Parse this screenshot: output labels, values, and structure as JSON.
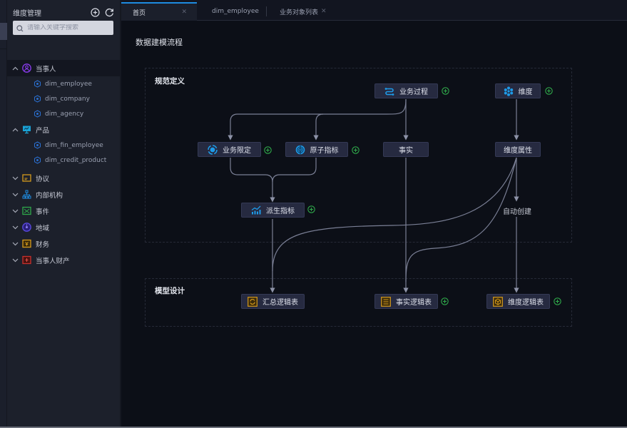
{
  "sidebar": {
    "title": "维度管理",
    "add_icon": "add-circle-icon",
    "refresh_icon": "refresh-icon",
    "search": {
      "placeholder": "请输入关键字搜索",
      "value": ""
    },
    "groups": [
      {
        "label": "当事人",
        "expanded": true,
        "icon": "person-icon",
        "color": "#8b3cf0",
        "children": [
          "dim_employee",
          "dim_company",
          "dim_agency"
        ]
      },
      {
        "label": "产品",
        "expanded": true,
        "icon": "monitor-icon",
        "color": "#1aa3d6",
        "children": [
          "dim_fin_employee",
          "dim_credit_product"
        ]
      },
      {
        "label": "协议",
        "expanded": false,
        "icon": "agreement-icon",
        "color": "#d49a1c"
      },
      {
        "label": "内部机构",
        "expanded": false,
        "icon": "org-icon",
        "color": "#1e8be0"
      },
      {
        "label": "事件",
        "expanded": false,
        "icon": "event-icon",
        "color": "#2fa84a"
      },
      {
        "label": "地域",
        "expanded": false,
        "icon": "region-icon",
        "color": "#5a4ae0"
      },
      {
        "label": "财务",
        "expanded": false,
        "icon": "finance-icon",
        "color": "#d49a1c"
      },
      {
        "label": "当事人财产",
        "expanded": false,
        "icon": "asset-icon",
        "color": "#c8302c"
      }
    ]
  },
  "tabs": [
    {
      "label": "首页",
      "active": true,
      "closable": true
    },
    {
      "label": "dim_employee",
      "active": false,
      "closable": false
    },
    {
      "label": "业务对象列表",
      "active": false,
      "closable": true
    }
  ],
  "page": {
    "title": "数据建模流程"
  },
  "diagram": {
    "sections": {
      "spec": "规范定义",
      "model": "模型设计"
    },
    "nodes": {
      "business_process": "业务过程",
      "dimension": "维度",
      "business_limit": "业务限定",
      "atomic_metric": "原子指标",
      "fact": "事实",
      "dimension_attr": "维度属性",
      "derived_metric": "派生指标",
      "summary_table": "汇总逻辑表",
      "fact_table": "事实逻辑表",
      "dimension_table": "维度逻辑表"
    },
    "auto_create_label": "自动创建"
  },
  "colors": {
    "accent": "#1e8be0",
    "plus": "#2fa84a",
    "table_icon": "#d49a1c"
  }
}
